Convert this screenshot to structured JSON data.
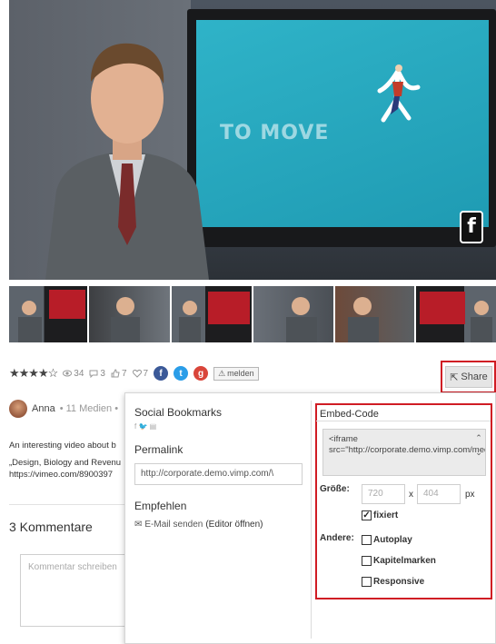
{
  "video": {
    "screen_text": "TO MOVE",
    "badge": "f"
  },
  "thumbnails": [
    {
      "texts": "THE 5 HAS... AN ORDER IMPROVE... ORDERING AND"
    },
    {
      "texts": ""
    },
    {
      "texts": "BEHIND OUR MIND, DECIDES VISION FILTERS THROUGH EMOTION"
    },
    {
      "texts": ""
    },
    {
      "texts": ""
    },
    {
      "texts": "MENTAL FILTERS DETERMINE THE IMPACT OF WHAT YOU SEE AND EXPERIENCE"
    },
    {
      "texts": ""
    }
  ],
  "stats": {
    "stars": "★★★★☆",
    "views": "34",
    "comments": "3",
    "likes": "7",
    "favorites": "7",
    "melden": "melden"
  },
  "share": {
    "label": "Share"
  },
  "author": {
    "name": "Anna",
    "sub": "• 11 Medien •"
  },
  "description": {
    "line1": "An interesting video about b",
    "line2": "„Design, Biology and Revenu",
    "line3": "https://vimeo.com/8900397"
  },
  "comments": {
    "title": "3 Kommentare",
    "placeholder": "Kommentar schreiben"
  },
  "popup": {
    "social_title": "Social Bookmarks",
    "social_icons": "f  🐦  ▤",
    "permalink_title": "Permalink",
    "permalink_value": "http://corporate.demo.vimp.com/\\",
    "empfehlen_title": "Empfehlen",
    "email_label": "E-Mail senden",
    "editor_label": "(Editor öffnen)"
  },
  "embed": {
    "title": "Embed-Code",
    "code": "<iframe src=\"http://corporate.demo.vimp.com/media",
    "size_label": "Größe:",
    "width": "720",
    "height": "404",
    "x": "x",
    "unit": "px",
    "fixed_label": "fixiert",
    "other_label": "Andere:",
    "autoplay_label": "Autoplay",
    "chapters_label": "Kapitelmarken",
    "responsive_label": "Responsive"
  }
}
